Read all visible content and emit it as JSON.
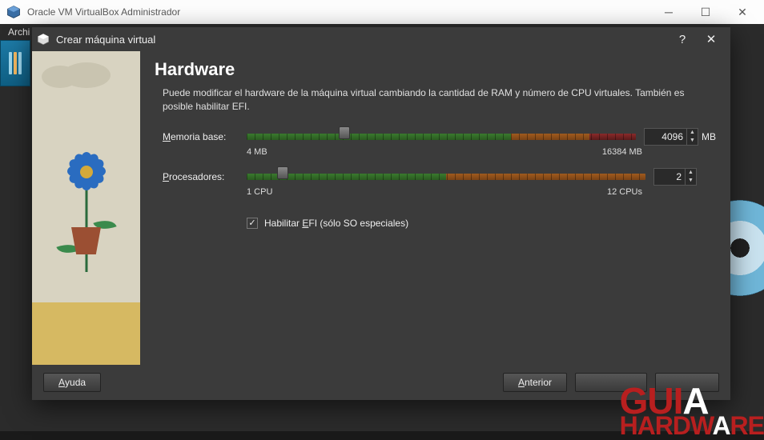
{
  "main_window": {
    "title": "Oracle VM VirtualBox Administrador",
    "menu_item": "Archi"
  },
  "dialog": {
    "title": "Crear máquina virtual",
    "heading": "Hardware",
    "description": "Puede modificar el hardware de la máquina virtual cambiando la cantidad de RAM y número de CPU virtuales. También es posible habilitar EFI.",
    "memory": {
      "label_pre": "M",
      "label_post": "emoria base:",
      "value": "4096",
      "unit": "MB",
      "min_label": "4 MB",
      "max_label": "16384 MB"
    },
    "cpu": {
      "label_pre": "P",
      "label_post": "rocesadores:",
      "value": "2",
      "min_label": "1 CPU",
      "max_label": "12 CPUs"
    },
    "efi": {
      "checked": true,
      "label_pre": "Habilitar ",
      "label_u": "E",
      "label_post": "FI (sólo SO especiales)"
    },
    "buttons": {
      "help_u": "A",
      "help_post": "yuda",
      "prev_u": "A",
      "prev_post": "nterior"
    }
  },
  "watermark": {
    "line1a": "GUI",
    "line1b": "A",
    "line2a": "HARDW",
    "line2b": "A",
    "line2c": "RE"
  }
}
